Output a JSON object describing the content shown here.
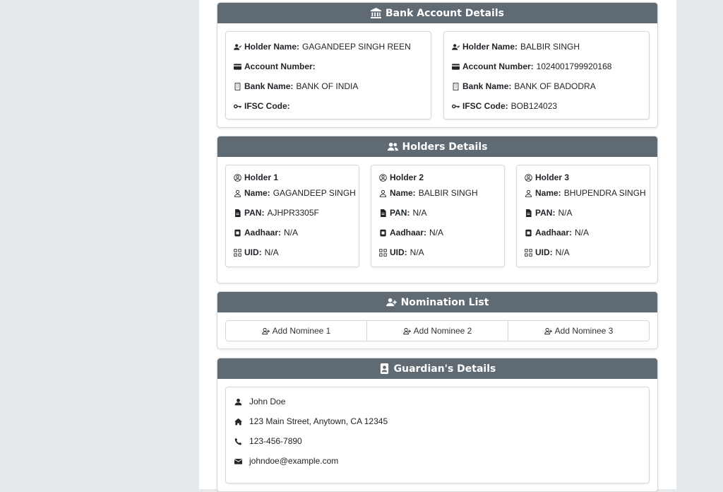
{
  "bank": {
    "title": "Bank Account Details",
    "accounts": [
      {
        "holder_label": "Holder Name:",
        "holder_value": "GAGANDEEP SINGH REEN",
        "account_label": "Account Number:",
        "account_value": "",
        "bank_label": "Bank Name:",
        "bank_value": "BANK OF INDIA",
        "ifsc_label": "IFSC Code:",
        "ifsc_value": ""
      },
      {
        "holder_label": "Holder Name:",
        "holder_value": "BALBIR SINGH",
        "account_label": "Account Number:",
        "account_value": "1024001799920168",
        "bank_label": "Bank Name:",
        "bank_value": "BANK OF BADODRA",
        "ifsc_label": "IFSC Code:",
        "ifsc_value": "BOB124023"
      }
    ]
  },
  "holders": {
    "title": "Holders Details",
    "items": [
      {
        "title": "Holder 1",
        "name_label": "Name:",
        "name": "GAGANDEEP SINGH",
        "pan_label": "PAN:",
        "pan": "AJHPR3305F",
        "aadhaar_label": "Aadhaar:",
        "aadhaar": "N/A",
        "uid_label": "UID:",
        "uid": "N/A"
      },
      {
        "title": "Holder 2",
        "name_label": "Name:",
        "name": "BALBIR SINGH",
        "pan_label": "PAN:",
        "pan": "N/A",
        "aadhaar_label": "Aadhaar:",
        "aadhaar": "N/A",
        "uid_label": "UID:",
        "uid": "N/A"
      },
      {
        "title": "Holder 3",
        "name_label": "Name:",
        "name": "BHUPENDRA SINGH",
        "pan_label": "PAN:",
        "pan": "N/A",
        "aadhaar_label": "Aadhaar:",
        "aadhaar": "N/A",
        "uid_label": "UID:",
        "uid": "N/A"
      }
    ]
  },
  "nomination": {
    "title": "Nomination List",
    "buttons": [
      "Add Nominee 1",
      "Add Nominee 2",
      "Add Nominee 3"
    ]
  },
  "guardian": {
    "title": "Guardian's Details",
    "name": "John Doe",
    "address": "123 Main Street, Anytown, CA 12345",
    "phone": "123-456-7890",
    "email": "johndoe@example.com"
  },
  "colors": {
    "header_bg": "#5f6a72",
    "page_bg": "#e7eaed"
  }
}
